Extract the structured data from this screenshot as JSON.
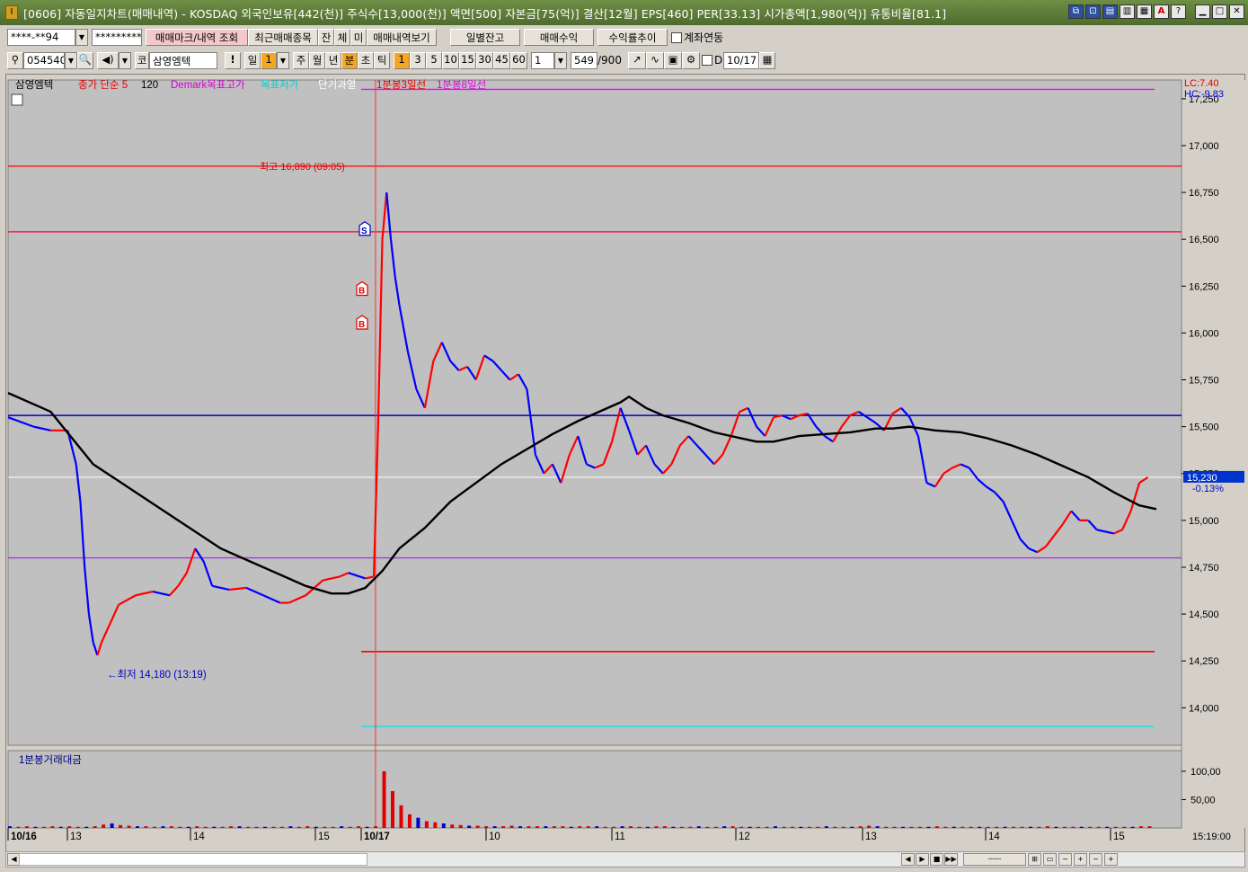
{
  "window": {
    "title": "[0606] 자동일지차트(매매내역) - KOSDAQ 외국인보유[442(천)] 주식수[13,000(천)] 액면[500] 자본금[75(억)] 결산[12월] EPS[460] PER[33.13] 시가총액[1,980(억)] 유통비율[81.1]",
    "icon_text": "I"
  },
  "toolbar1": {
    "account": "****-**94",
    "password": "*********",
    "mark_button": "매매마크/내역 조회",
    "recent_button": "최근매매종목",
    "tab_jan": "잔",
    "tab_che": "체",
    "tab_mi": "미",
    "history_button": "매매내역보기",
    "daily_balance": "일별잔고",
    "trade_profit": "매매수익",
    "profit_trend": "수익률추이",
    "account_link_label": "계좌연동"
  },
  "toolbar2": {
    "code": "054540",
    "market": "코",
    "stock_name": "삼영엠텍",
    "period_day": "일",
    "period_value": "1",
    "period_week": "주",
    "period_month": "월",
    "period_year": "년",
    "period_min": "분",
    "period_sec": "초",
    "period_tick": "틱",
    "minute_options": [
      "1",
      "3",
      "5",
      "10",
      "15",
      "30",
      "45",
      "60"
    ],
    "minute_selected": "1",
    "step_value": "1",
    "count": "549",
    "count_total": "/900",
    "date_check_label": "D",
    "date": "10/17"
  },
  "legend": {
    "stock": "삼영엠텍",
    "ma": "종가 단순 5",
    "ma_period": "120",
    "demark_high": "Demark목표고가",
    "demark_low": "목표저가",
    "short_overheat": "단기과열",
    "line3": "1분봉3일선",
    "line8": "1분봉8일선"
  },
  "price_axis": {
    "lc": "LC:7.40",
    "hc": "HC:-9.83",
    "ticks": [
      "17,250",
      "17,000",
      "16,750",
      "16,500",
      "16,250",
      "16,000",
      "15,750",
      "15,500",
      "15,250",
      "15,000",
      "14,750",
      "14,500",
      "14,250",
      "14,000"
    ],
    "current_price": "15,230",
    "current_change": "-0.13%"
  },
  "annotations": {
    "high": "최고 16,890 (09:05)",
    "low": "최저 14,180 (13:19)",
    "sell_mark": "S",
    "buy_mark": "B"
  },
  "volume_panel": {
    "title": "1분봉거래대금",
    "ticks": [
      "100,00",
      "50,00"
    ]
  },
  "time_axis": {
    "labels": [
      "10/16",
      "13",
      "14",
      "15",
      "10/17",
      "10",
      "11",
      "12",
      "13",
      "14",
      "15"
    ],
    "clock": "15:19:00"
  },
  "colors": {
    "chart_bg": "#c0c0c0",
    "up": "#ff0000",
    "down": "#0000ff",
    "ma": "#000000",
    "demark_high": "#ff00ff",
    "demark_low": "#00e5e5"
  },
  "chart_data": {
    "type": "line",
    "title": "",
    "price_range": [
      13800,
      17350
    ],
    "levels": [
      {
        "name": "1분봉8일선",
        "value": 17300,
        "color": "#ff00ff"
      },
      {
        "name": "최고",
        "value": 16890,
        "color": "#ff0000"
      },
      {
        "name": "1분봉3일선",
        "value": 16540,
        "color": "#ff0040"
      },
      {
        "name": "",
        "value": 15560,
        "color": "#0000c0"
      },
      {
        "name": "",
        "value": 14800,
        "color": "#a040d0"
      },
      {
        "name": "",
        "value": 14300,
        "color": "#ff0000"
      },
      {
        "name": "목표저가",
        "value": 13900,
        "color": "#00e5e5"
      }
    ],
    "series": [
      {
        "name": "",
        "points": [
          [
            0,
            15550
          ],
          [
            3,
            15500
          ],
          [
            5,
            15480
          ],
          [
            7,
            15480
          ],
          [
            8,
            15300
          ],
          [
            8.5,
            15100
          ],
          [
            9,
            14750
          ],
          [
            9.5,
            14500
          ],
          [
            10,
            14350
          ],
          [
            10.5,
            14280
          ],
          [
            11,
            14350
          ],
          [
            12,
            14450
          ],
          [
            13,
            14550
          ],
          [
            15,
            14600
          ],
          [
            17,
            14620
          ],
          [
            19,
            14600
          ],
          [
            20,
            14650
          ],
          [
            21,
            14720
          ],
          [
            22,
            14850
          ],
          [
            23,
            14780
          ],
          [
            24,
            14650
          ],
          [
            26,
            14630
          ],
          [
            28,
            14640
          ],
          [
            30,
            14600
          ],
          [
            32,
            14560
          ],
          [
            33,
            14560
          ],
          [
            35,
            14600
          ],
          [
            37,
            14680
          ],
          [
            39,
            14700
          ],
          [
            40,
            14720
          ],
          [
            42,
            14690
          ],
          [
            43,
            14700
          ],
          [
            43.5,
            15500
          ],
          [
            44,
            16500
          ],
          [
            44.5,
            16750
          ],
          [
            45,
            16500
          ],
          [
            45.5,
            16300
          ],
          [
            46,
            16150
          ],
          [
            47,
            15900
          ],
          [
            48,
            15700
          ],
          [
            49,
            15600
          ],
          [
            50,
            15850
          ],
          [
            51,
            15950
          ],
          [
            52,
            15850
          ],
          [
            53,
            15800
          ],
          [
            54,
            15820
          ],
          [
            55,
            15750
          ],
          [
            56,
            15880
          ],
          [
            57,
            15850
          ],
          [
            58,
            15800
          ],
          [
            59,
            15750
          ],
          [
            60,
            15780
          ],
          [
            61,
            15700
          ],
          [
            62,
            15350
          ],
          [
            63,
            15250
          ],
          [
            64,
            15300
          ],
          [
            65,
            15200
          ],
          [
            66,
            15350
          ],
          [
            67,
            15450
          ],
          [
            68,
            15300
          ],
          [
            69,
            15280
          ],
          [
            70,
            15300
          ],
          [
            71,
            15420
          ],
          [
            72,
            15600
          ],
          [
            73,
            15480
          ],
          [
            74,
            15350
          ],
          [
            75,
            15400
          ],
          [
            76,
            15300
          ],
          [
            77,
            15250
          ],
          [
            78,
            15300
          ],
          [
            79,
            15400
          ],
          [
            80,
            15450
          ],
          [
            81,
            15400
          ],
          [
            82,
            15350
          ],
          [
            83,
            15300
          ],
          [
            84,
            15350
          ],
          [
            85,
            15450
          ],
          [
            86,
            15580
          ],
          [
            87,
            15600
          ],
          [
            88,
            15500
          ],
          [
            89,
            15450
          ],
          [
            90,
            15550
          ],
          [
            91,
            15560
          ],
          [
            92,
            15540
          ],
          [
            93,
            15560
          ],
          [
            94,
            15570
          ],
          [
            95,
            15500
          ],
          [
            96,
            15450
          ],
          [
            97,
            15420
          ],
          [
            98,
            15500
          ],
          [
            99,
            15560
          ],
          [
            100,
            15580
          ],
          [
            101,
            15550
          ],
          [
            102,
            15520
          ],
          [
            103,
            15480
          ],
          [
            104,
            15570
          ],
          [
            105,
            15600
          ],
          [
            106,
            15550
          ],
          [
            107,
            15450
          ],
          [
            108,
            15200
          ],
          [
            109,
            15180
          ],
          [
            110,
            15250
          ],
          [
            111,
            15280
          ],
          [
            112,
            15300
          ],
          [
            113,
            15280
          ],
          [
            114,
            15220
          ],
          [
            115,
            15180
          ],
          [
            116,
            15150
          ],
          [
            117,
            15100
          ],
          [
            118,
            15000
          ],
          [
            119,
            14900
          ],
          [
            120,
            14850
          ],
          [
            121,
            14830
          ],
          [
            122,
            14860
          ],
          [
            123,
            14920
          ],
          [
            124,
            14980
          ],
          [
            125,
            15050
          ],
          [
            126,
            15000
          ],
          [
            127,
            15000
          ],
          [
            128,
            14950
          ],
          [
            129,
            14940
          ],
          [
            130,
            14930
          ],
          [
            131,
            14950
          ],
          [
            132,
            15050
          ],
          [
            133,
            15200
          ],
          [
            134,
            15230
          ]
        ]
      },
      {
        "name": "120",
        "points": [
          [
            0,
            15680
          ],
          [
            5,
            15580
          ],
          [
            10,
            15300
          ],
          [
            15,
            15150
          ],
          [
            20,
            15000
          ],
          [
            25,
            14850
          ],
          [
            30,
            14750
          ],
          [
            35,
            14650
          ],
          [
            38,
            14610
          ],
          [
            40,
            14610
          ],
          [
            42,
            14640
          ],
          [
            44,
            14730
          ],
          [
            46,
            14850
          ],
          [
            49,
            14960
          ],
          [
            52,
            15100
          ],
          [
            55,
            15200
          ],
          [
            58,
            15300
          ],
          [
            61,
            15380
          ],
          [
            64,
            15460
          ],
          [
            67,
            15530
          ],
          [
            70,
            15590
          ],
          [
            72,
            15630
          ],
          [
            73,
            15660
          ],
          [
            75,
            15600
          ],
          [
            77,
            15560
          ],
          [
            80,
            15520
          ],
          [
            83,
            15470
          ],
          [
            86,
            15440
          ],
          [
            88,
            15420
          ],
          [
            90,
            15420
          ],
          [
            93,
            15450
          ],
          [
            96,
            15460
          ],
          [
            99,
            15470
          ],
          [
            102,
            15490
          ],
          [
            104,
            15490
          ],
          [
            106,
            15500
          ],
          [
            109,
            15480
          ],
          [
            112,
            15470
          ],
          [
            115,
            15440
          ],
          [
            118,
            15400
          ],
          [
            121,
            15350
          ],
          [
            124,
            15290
          ],
          [
            127,
            15230
          ],
          [
            130,
            15150
          ],
          [
            133,
            15080
          ],
          [
            135,
            15060
          ]
        ]
      }
    ],
    "volume": [
      3,
      2,
      3,
      2,
      2,
      3,
      2,
      3,
      2,
      2,
      3,
      6,
      8,
      5,
      4,
      3,
      3,
      2,
      3,
      3,
      2,
      2,
      3,
      2,
      2,
      2,
      3,
      3,
      2,
      2,
      2,
      2,
      2,
      3,
      2,
      3,
      2,
      2,
      2,
      3,
      2,
      3,
      2,
      3,
      100,
      65,
      40,
      24,
      18,
      12,
      10,
      8,
      6,
      5,
      4,
      4,
      3,
      3,
      3,
      4,
      3,
      3,
      3,
      3,
      3,
      3,
      2,
      3,
      3,
      3,
      2,
      2,
      3,
      3,
      2,
      2,
      3,
      3,
      2,
      2,
      2,
      3,
      2,
      2,
      3,
      3,
      2,
      2,
      2,
      2,
      3,
      2,
      2,
      2,
      2,
      2,
      3,
      2,
      2,
      2,
      3,
      4,
      3,
      2,
      2,
      2,
      2,
      2,
      2,
      3,
      2,
      2,
      2,
      2,
      2,
      2,
      2,
      2,
      2,
      2,
      2,
      2,
      3,
      2,
      2,
      2,
      2,
      2,
      2,
      2,
      2,
      2,
      2,
      3,
      3
    ],
    "volume_range": [
      0,
      130
    ]
  }
}
